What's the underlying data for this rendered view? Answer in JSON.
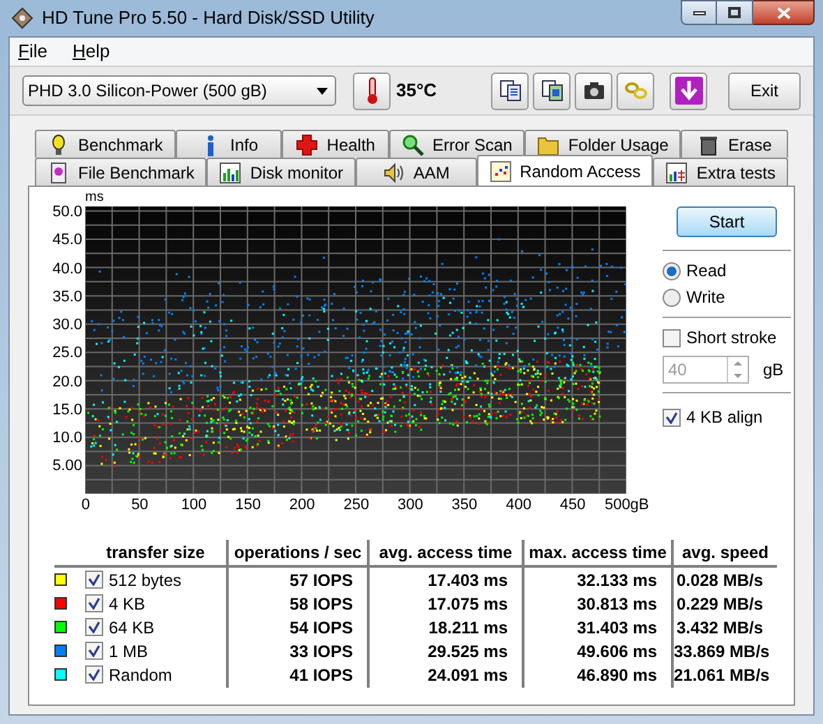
{
  "window": {
    "title": "HD Tune Pro 5.50 - Hard Disk/SSD Utility"
  },
  "menu": [
    {
      "label": "File"
    },
    {
      "label": "Help"
    }
  ],
  "toolbar": {
    "drive": "PHD 3.0 Silicon-Power (500 gB)",
    "temperature": "35°C",
    "exit": "Exit"
  },
  "tabs_top": [
    {
      "label": "Benchmark",
      "kind": "bulb",
      "selected": false
    },
    {
      "label": "Info",
      "kind": "info",
      "selected": false
    },
    {
      "label": "Health",
      "kind": "cross",
      "selected": false
    },
    {
      "label": "Error Scan",
      "kind": "magnifier",
      "selected": false
    },
    {
      "label": "Folder Usage",
      "kind": "folder",
      "selected": false
    },
    {
      "label": "Erase",
      "kind": "bin",
      "selected": false
    }
  ],
  "tabs_bottom": [
    {
      "label": "File Benchmark",
      "kind": "file",
      "selected": false
    },
    {
      "label": "Disk monitor",
      "kind": "bars",
      "selected": false
    },
    {
      "label": "AAM",
      "kind": "speaker",
      "selected": false
    },
    {
      "label": "Random Access",
      "kind": "scatter",
      "selected": true
    },
    {
      "label": "Extra tests",
      "kind": "grid",
      "selected": false
    }
  ],
  "chart": {
    "y_unit": "ms",
    "y_ticks": [
      "50.0",
      "45.0",
      "40.0",
      "35.0",
      "30.0",
      "25.0",
      "20.0",
      "15.0",
      "10.0",
      "5.00"
    ],
    "x_ticks": [
      "0",
      "50",
      "100",
      "150",
      "200",
      "250",
      "300",
      "350",
      "400",
      "450",
      "500gB"
    ]
  },
  "controls": {
    "start": "Start",
    "modes": [
      {
        "label": "Read",
        "selected": true
      },
      {
        "label": "Write",
        "selected": false
      }
    ],
    "short_stroke": {
      "label": "Short stroke",
      "checked": false
    },
    "size": {
      "value": "40",
      "unit": "gB",
      "disabled": true
    },
    "align": {
      "label": "4 KB align",
      "checked": true
    }
  },
  "table": {
    "columns": [
      "transfer size",
      "operations / sec",
      "avg. access time",
      "max. access time",
      "avg. speed"
    ],
    "rows": [
      {
        "color": "#ffff00",
        "checked": true,
        "cells": [
          "512 bytes",
          "57 IOPS",
          "17.403 ms",
          "32.133 ms",
          "0.028 MB/s"
        ]
      },
      {
        "color": "#ff0000",
        "checked": true,
        "cells": [
          "4 KB",
          "58 IOPS",
          "17.075 ms",
          "30.813 ms",
          "0.229 MB/s"
        ]
      },
      {
        "color": "#00ff00",
        "checked": true,
        "cells": [
          "64 KB",
          "54 IOPS",
          "18.211 ms",
          "31.403 ms",
          "3.432 MB/s"
        ]
      },
      {
        "color": "#0080ff",
        "checked": true,
        "cells": [
          "1 MB",
          "33 IOPS",
          "29.525 ms",
          "49.606 ms",
          "33.869 MB/s"
        ]
      },
      {
        "color": "#00ffff",
        "checked": true,
        "cells": [
          "Random",
          "41 IOPS",
          "24.091 ms",
          "46.890 ms",
          "21.061 MB/s"
        ]
      }
    ]
  }
}
